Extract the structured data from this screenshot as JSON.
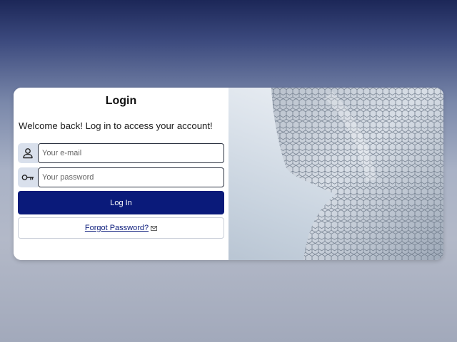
{
  "login": {
    "title": "Login",
    "welcome": "Welcome back! Log in to access your account!",
    "email": {
      "placeholder": "Your e-mail",
      "icon": "user-icon"
    },
    "password": {
      "placeholder": "Your password",
      "icon": "key-icon"
    },
    "login_button": "Log In",
    "forgot_link": "Forgot Password?",
    "forgot_icon": "envelope-icon"
  },
  "colors": {
    "primary": "#0a1a7a",
    "icon_box": "#d9e0ec",
    "card": "#ffffff"
  },
  "image": {
    "subject": "building-facade-hexagonal-tiles"
  }
}
